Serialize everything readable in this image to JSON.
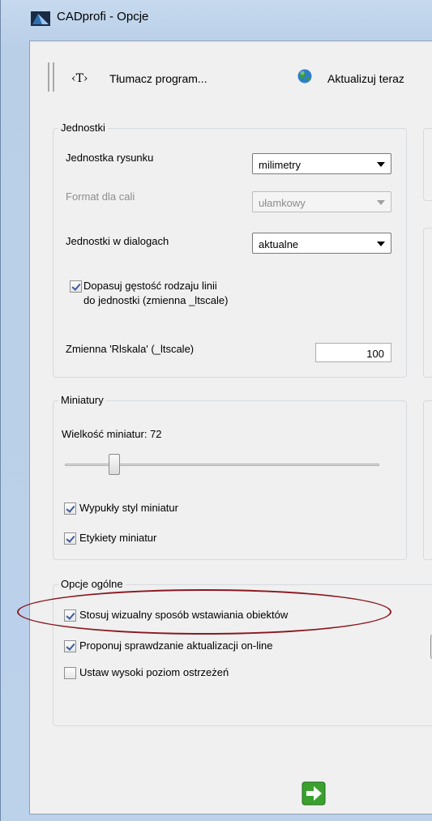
{
  "window": {
    "title": "CADprofi - Opcje"
  },
  "toolbar": {
    "t_icon": "‹T›",
    "translate_label": "Tłumacz program...",
    "update_label": "Aktualizuj teraz"
  },
  "units": {
    "group_title": "Jednostki",
    "drawing_unit_label": "Jednostka rysunku",
    "drawing_unit_value": "milimetry",
    "inch_format_label": "Format dla cali",
    "inch_format_value": "ułamkowy",
    "dialog_units_label": "Jednostki w dialogach",
    "dialog_units_value": "aktualne",
    "linetype_check_line1": "Dopasuj gęstość rodzaju linii",
    "linetype_check_line2": "do jednostki (zmienna _ltscale)",
    "ltscale_label": "Zmienna 'Rlskala' (_ltscale)",
    "ltscale_value": "100"
  },
  "thumbnails": {
    "group_title": "Miniatury",
    "size_label": "Wielkość miniatur: 72",
    "size_value": 72,
    "convex_label": "Wypukły styl miniatur",
    "labels_label": "Etykiety miniatur"
  },
  "general": {
    "group_title": "Opcje ogólne",
    "visual_insert_label": "Stosuj wizualny sposób wstawiania obiektów",
    "update_check_label": "Proponuj sprawdzanie aktualizacji on-line",
    "warnings_label": "Ustaw wysoki poziom ostrzeżeń"
  },
  "colors": {
    "accent_green": "#3aa12e",
    "annotation_oval": "#8a1820"
  }
}
